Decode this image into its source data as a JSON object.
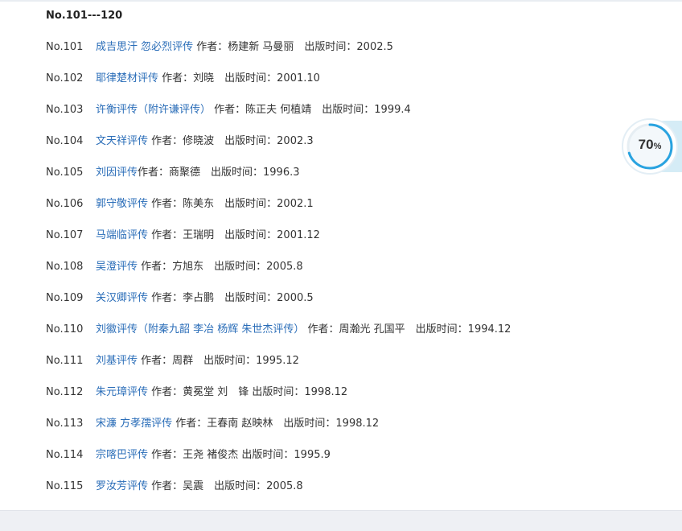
{
  "section": {
    "title": "No.101---120"
  },
  "books": [
    {
      "no": "No.101",
      "title": "成吉思汗 忽必烈评传",
      "meta": " 作者：杨建新 马曼丽　出版时间：2002.5"
    },
    {
      "no": "No.102",
      "title": "耶律楚材评传",
      "meta": " 作者：刘晓　出版时间：2001.10"
    },
    {
      "no": "No.103",
      "title": "许衡评传（附许谦评传）",
      "meta": " 作者：陈正夫 何植靖　出版时间：1999.4"
    },
    {
      "no": "No.104",
      "title": "文天祥评传",
      "meta": " 作者：修晓波　出版时间：2002.3"
    },
    {
      "no": "No.105",
      "title": "刘因评传",
      "meta": "作者：商聚德　出版时间：1996.3"
    },
    {
      "no": "No.106",
      "title": "郭守敬评传",
      "meta": " 作者：陈美东　出版时间：2002.1"
    },
    {
      "no": "No.107",
      "title": "马端临评传",
      "meta": " 作者：王瑞明　出版时间：2001.12"
    },
    {
      "no": "No.108",
      "title": "吴澄评传",
      "meta": " 作者：方旭东　出版时间：2005.8"
    },
    {
      "no": "No.109",
      "title": "关汉卿评传",
      "meta": " 作者：李占鹏　出版时间：2000.5"
    },
    {
      "no": "No.110",
      "title": "刘徽评传（附秦九韶 李冶 杨辉 朱世杰评传）",
      "meta": " 作者：周瀚光 孔国平　出版时间：1994.12"
    },
    {
      "no": "No.111",
      "title": "刘基评传",
      "meta": " 作者：周群　出版时间：1995.12"
    },
    {
      "no": "No.112",
      "title": "朱元璋评传",
      "meta": " 作者：黄冕堂 刘　锋 出版时间：1998.12"
    },
    {
      "no": "No.113",
      "title": "宋濂 方孝孺评传",
      "meta": " 作者：王春南 赵映林　出版时间：1998.12"
    },
    {
      "no": "No.114",
      "title": "宗喀巴评传",
      "meta": " 作者：王尧 褚俊杰 出版时间：1995.9"
    },
    {
      "no": "No.115",
      "title": "罗汝芳评传",
      "meta": " 作者：吴震　出版时间：2005.8"
    }
  ],
  "progress": {
    "value": "70",
    "unit": "%",
    "fraction": 0.7
  },
  "colors": {
    "link": "#2a6db8",
    "ring": "#29a3e0",
    "tab": "#d5ecf6"
  }
}
